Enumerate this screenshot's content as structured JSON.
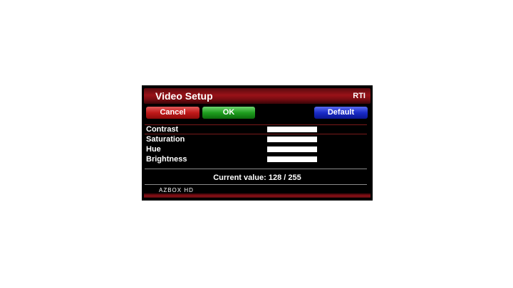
{
  "dialog": {
    "title": "Video Setup",
    "channel": "RTI"
  },
  "buttons": {
    "cancel": "Cancel",
    "ok": "OK",
    "default": "Default"
  },
  "settings": [
    {
      "label": "Contrast",
      "value": 255,
      "max": 255
    },
    {
      "label": "Saturation",
      "value": 255,
      "max": 255
    },
    {
      "label": "Hue",
      "value": 255,
      "max": 255
    },
    {
      "label": "Brightness",
      "value": 255,
      "max": 255
    }
  ],
  "status": {
    "current_value": "Current value: 128 / 255"
  },
  "brand": {
    "name": "AZBOX HD"
  },
  "colors": {
    "cancel": "#c11a1a",
    "ok": "#1f9e1f",
    "default": "#1a2cc8",
    "title_bar": "#9a1218"
  }
}
